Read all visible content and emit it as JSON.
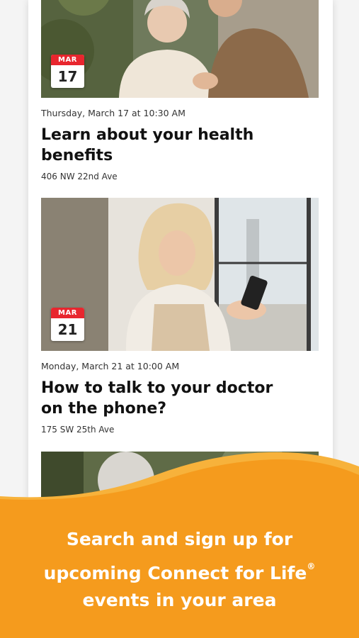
{
  "events": [
    {
      "month": "MAR",
      "day": "17",
      "datetime": "Thursday, March 17 at 10:30 AM",
      "title": "Learn about your health benefits",
      "address": "406 NW 22nd Ave"
    },
    {
      "month": "MAR",
      "day": "21",
      "datetime": "Monday, March 21 at 10:00 AM",
      "title": "How to talk to your doctor on the phone?",
      "address": "175 SW 25th Ave"
    }
  ],
  "promo": {
    "line1": "Search and sign up for",
    "line2": "upcoming Connect for Life",
    "registered_mark": "®",
    "line3": "events in your area"
  },
  "colors": {
    "promo_orange": "#f59b1d",
    "promo_orange_light": "#f7b23b",
    "badge_red": "#e8262e"
  }
}
